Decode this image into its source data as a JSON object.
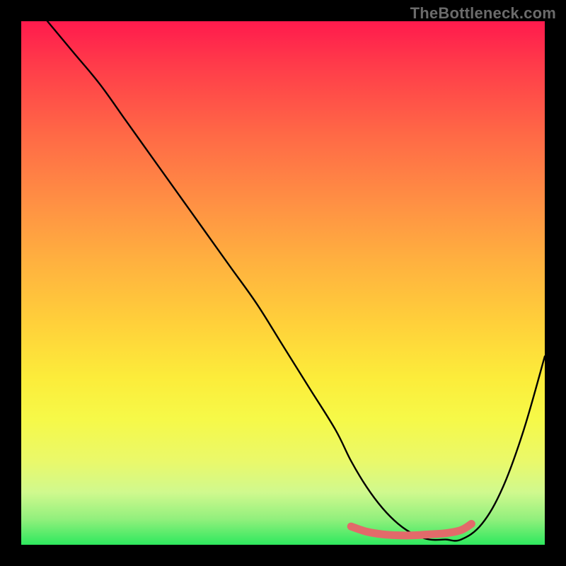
{
  "watermark": "TheBottleneck.com",
  "chart_data": {
    "type": "line",
    "title": "",
    "xlabel": "",
    "ylabel": "",
    "xlim": [
      0,
      100
    ],
    "ylim": [
      0,
      100
    ],
    "series": [
      {
        "name": "bottleneck-curve",
        "x": [
          5,
          10,
          15,
          20,
          25,
          30,
          35,
          40,
          45,
          50,
          55,
          60,
          63,
          66,
          69,
          72,
          75,
          78,
          81,
          84,
          88,
          92,
          96,
          100
        ],
        "values": [
          100,
          94,
          88,
          81,
          74,
          67,
          60,
          53,
          46,
          38,
          30,
          22,
          16,
          11,
          7,
          4,
          2,
          1,
          1,
          1,
          4,
          11,
          22,
          36
        ]
      },
      {
        "name": "optimal-band",
        "x": [
          63,
          66,
          69,
          72,
          75,
          78,
          81,
          84,
          86
        ],
        "values": [
          3.5,
          2.5,
          2,
          1.8,
          1.8,
          2,
          2.2,
          2.8,
          4
        ]
      }
    ],
    "gradient_stops": [
      {
        "pos": 0,
        "color": "#ff1a4d"
      },
      {
        "pos": 8,
        "color": "#ff3a4a"
      },
      {
        "pos": 22,
        "color": "#ff6a46"
      },
      {
        "pos": 34,
        "color": "#ff8e44"
      },
      {
        "pos": 46,
        "color": "#ffb13f"
      },
      {
        "pos": 58,
        "color": "#ffd13a"
      },
      {
        "pos": 68,
        "color": "#fcec3a"
      },
      {
        "pos": 76,
        "color": "#f6f948"
      },
      {
        "pos": 84,
        "color": "#eaf96a"
      },
      {
        "pos": 90,
        "color": "#d0f98e"
      },
      {
        "pos": 95,
        "color": "#93f07d"
      },
      {
        "pos": 100,
        "color": "#2ee85e"
      }
    ],
    "curve_color": "#000000",
    "band_color": "#e26a6a"
  }
}
